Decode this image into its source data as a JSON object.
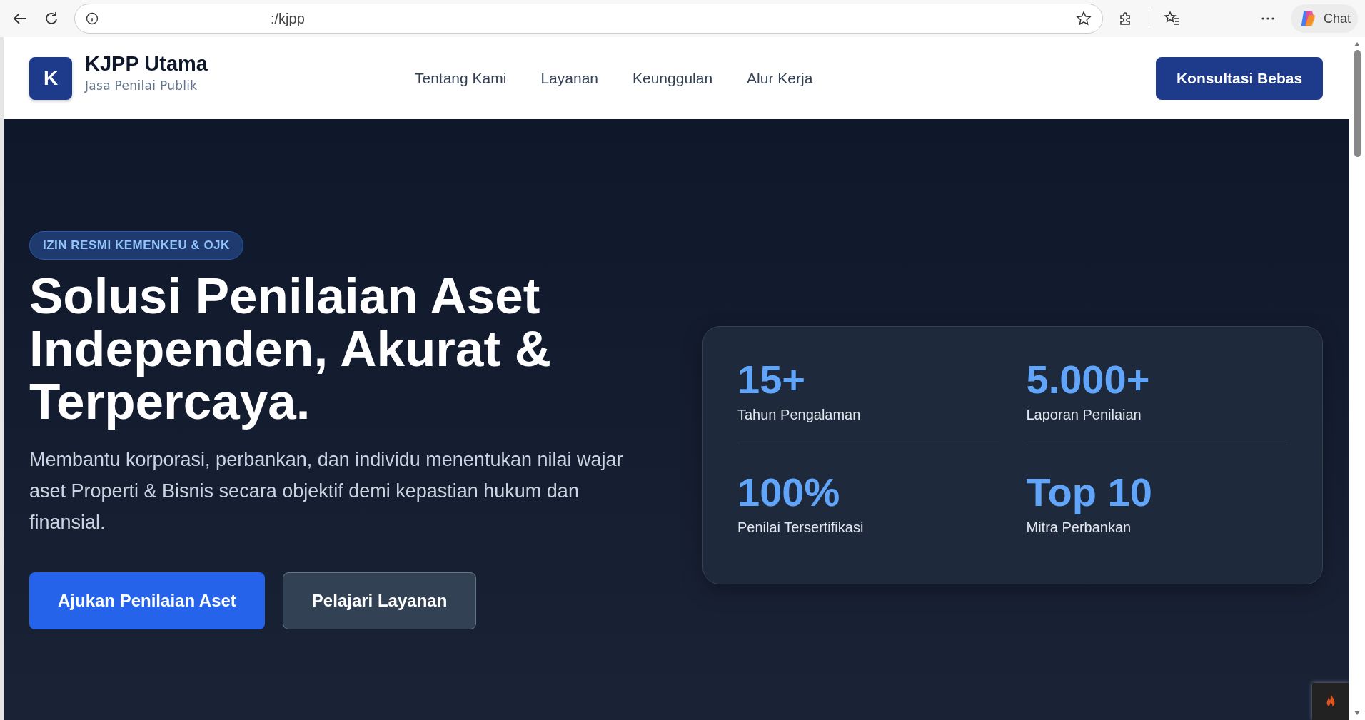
{
  "browser": {
    "url": ":/kjpp",
    "chat_label": "Chat"
  },
  "header": {
    "logo_letter": "K",
    "brand": "KJPP Utama",
    "tagline": "Jasa Penilai Publik",
    "nav": [
      {
        "label": "Tentang Kami"
      },
      {
        "label": "Layanan"
      },
      {
        "label": "Keunggulan"
      },
      {
        "label": "Alur Kerja"
      }
    ],
    "cta": "Konsultasi Bebas"
  },
  "hero": {
    "badge": "IZIN RESMI KEMENKEU & OJK",
    "title_lines": [
      "Solusi Penilaian Aset",
      "Independen, Akurat &",
      "Terpercaya."
    ],
    "description": "Membantu korporasi, perbankan, dan individu menentukan nilai wajar aset Properti & Bisnis secara objektif demi kepastian hukum dan finansial.",
    "buttons": [
      {
        "label": "Ajukan Penilaian Aset",
        "kind": "primary"
      },
      {
        "label": "Pelajari Layanan",
        "kind": "secondary"
      }
    ]
  },
  "stats": [
    {
      "value": "15+",
      "label": "Tahun Pengalaman"
    },
    {
      "value": "5.000+",
      "label": "Laporan Penilaian"
    },
    {
      "value": "100%",
      "label": "Penilai Tersertifikasi"
    },
    {
      "value": "Top 10",
      "label": "Mitra Perbankan"
    }
  ]
}
